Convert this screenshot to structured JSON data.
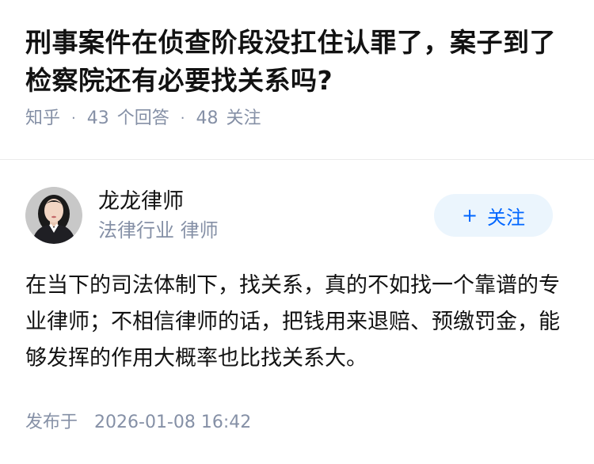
{
  "question": {
    "title": "刑事案件在侦查阶段没扛住认罪了，案子到了检察院还有必要找关系吗?",
    "source": "知乎",
    "answer_count": "43",
    "answer_label": "个回答",
    "follower_count": "48",
    "follower_label": "关注",
    "separator": "·"
  },
  "answer": {
    "author": {
      "name": "龙龙律师",
      "headline": "法律行业 律师",
      "avatar_icon": "avatar-photo"
    },
    "follow_button": {
      "icon": "plus-icon",
      "plus": "+",
      "label": "关注"
    },
    "content": "在当下的司法体制下，找关系，真的不如找一个靠谱的专业律师；不相信律师的话，把钱用来退赔、预缴罚金，能够发挥的作用大概率也比找关系大。",
    "published_label": "发布于",
    "published_time": "2026-01-08 16:42"
  },
  "colors": {
    "meta_gray": "#8590a6",
    "accent_blue": "#0066ff",
    "follow_bg": "#ebf5fd",
    "text": "#121212"
  }
}
